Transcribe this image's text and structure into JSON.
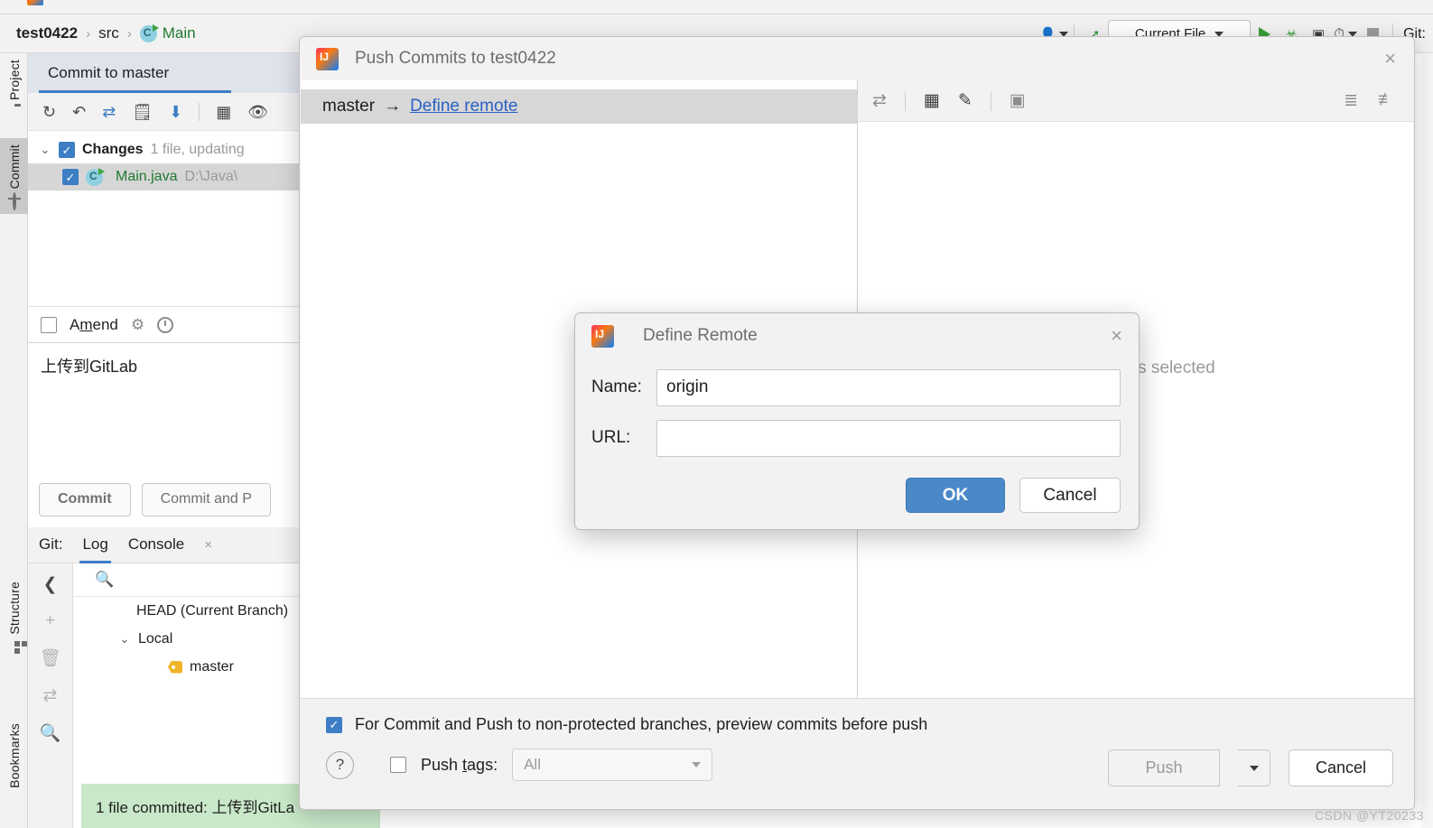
{
  "ide": {
    "breadcrumb": {
      "project": "test0422",
      "folder": "src",
      "file": "Main",
      "separator": "›"
    },
    "toolbar": {
      "run_config": "Current File",
      "git_label": "Git:",
      "icons": [
        "user-icon",
        "build-icon",
        "run-icon",
        "debug-icon",
        "run-with-coverage-icon",
        "profiler-icon",
        "stop-icon"
      ]
    },
    "left_tool_tabs": [
      {
        "label": "Project",
        "icon": "folder-icon",
        "active": false
      },
      {
        "label": "Commit",
        "icon": "commit-icon",
        "active": true
      },
      {
        "label": "Structure",
        "icon": "structure-icon",
        "active": false
      },
      {
        "label": "Bookmarks",
        "icon": "bookmark-icon",
        "active": false
      }
    ]
  },
  "commit_panel": {
    "tab_label": "Commit to master",
    "toolbar_icons": [
      "refresh-icon",
      "rollback-icon",
      "show-diff-icon",
      "commit-message-icon",
      "update-project-icon",
      "group-by-icon",
      "preview-diff-icon"
    ],
    "changes": {
      "node_label": "Changes",
      "node_detail": "1 file, updating",
      "file_name": "Main.java",
      "file_path": "D:\\Java\\"
    },
    "amend": {
      "label_pre": "A",
      "label_key": "m",
      "label_post": "end",
      "checked": false
    },
    "message": "上传到GitLab",
    "buttons": {
      "commit": "Commit",
      "commit_and_push": "Commit and P"
    }
  },
  "git_panel": {
    "title": "Git:",
    "tabs": [
      {
        "label": "Log",
        "active": true
      },
      {
        "label": "Console",
        "active": false
      }
    ],
    "close_glyph": "×",
    "side_icons": [
      "collapse-icon",
      "add-icon",
      "delete-icon",
      "show-diff-icon",
      "search-icon"
    ],
    "search_placeholder": "",
    "tree": [
      {
        "label": "HEAD (Current Branch)",
        "indent": 2,
        "icon": "none"
      },
      {
        "label": "Local",
        "indent": 1,
        "icon": "chevron-down"
      },
      {
        "label": "master",
        "indent": 3,
        "icon": "branch-tag"
      }
    ],
    "toast": "1 file committed: 上传到GitLa"
  },
  "push_dialog": {
    "title": "Push Commits to test0422",
    "close_glyph": "×",
    "branch_row": {
      "branch": "master",
      "arrow": "→",
      "link": "Define remote"
    },
    "right_panel": {
      "toolbar_icons": [
        "show-diff-icon",
        "group-by-icon",
        "edit-icon",
        "preview-icon",
        "expand-all-icon",
        "collapse-all-icon"
      ],
      "empty_text": "No commits selected"
    },
    "footer": {
      "preview_checkbox": {
        "label": "For Commit and Push to non-protected branches, preview commits before push",
        "checked": true
      },
      "help_glyph": "?",
      "push_tags": {
        "label_pre": "Push ",
        "label_key": "t",
        "label_post": "ags:",
        "checked": false,
        "value": "All"
      },
      "push_button": "Push",
      "cancel_button": "Cancel"
    }
  },
  "remote_dialog": {
    "title": "Define Remote",
    "close_glyph": "×",
    "fields": [
      {
        "label": "Name:",
        "value": "origin"
      },
      {
        "label": "URL:",
        "value": ""
      }
    ],
    "ok_button": "OK",
    "cancel_button": "Cancel"
  },
  "watermark": "CSDN @YT20233",
  "colors": {
    "accent_blue": "#3d7ec4",
    "ok_button_blue": "#4a88c7",
    "link_blue": "#2b61c4",
    "added_green": "#1f7a32",
    "toast_green": "#c9e8c9",
    "selected_gray": "#d7d7d7"
  }
}
